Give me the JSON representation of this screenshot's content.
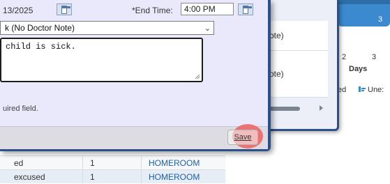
{
  "dialog": {
    "start_date": "13/2025",
    "end_time_label": "End Time:",
    "end_time_required_mark": "*",
    "end_time_value": "4:00 PM",
    "reason_selected": "k (No Doctor Note)",
    "comment_text": "child is sick.",
    "required_note": "uired field.",
    "save_label": "Save"
  },
  "middle_dialog": {
    "rows": [
      "ote)",
      "ote)"
    ]
  },
  "background_table": {
    "rows": [
      {
        "status": "ed",
        "count": "1",
        "location": "HOMEROOM"
      },
      {
        "status": "excused",
        "count": "1",
        "location": "HOMEROOM"
      }
    ]
  },
  "chart_data": {
    "type": "bar",
    "x_ticks": [
      "2",
      "3"
    ],
    "top_tick": "3",
    "xlabel": "Days",
    "legend": [
      "ed",
      "Une:"
    ],
    "colors": {
      "bar": "#3b8ad0",
      "bar_dark": "#2c6ea8"
    }
  },
  "colors": {
    "dialog_border": "#2a4f8a",
    "dialog_bg": "#e9e9fb",
    "highlight": "#ea6262",
    "link": "#1f5fa8"
  }
}
